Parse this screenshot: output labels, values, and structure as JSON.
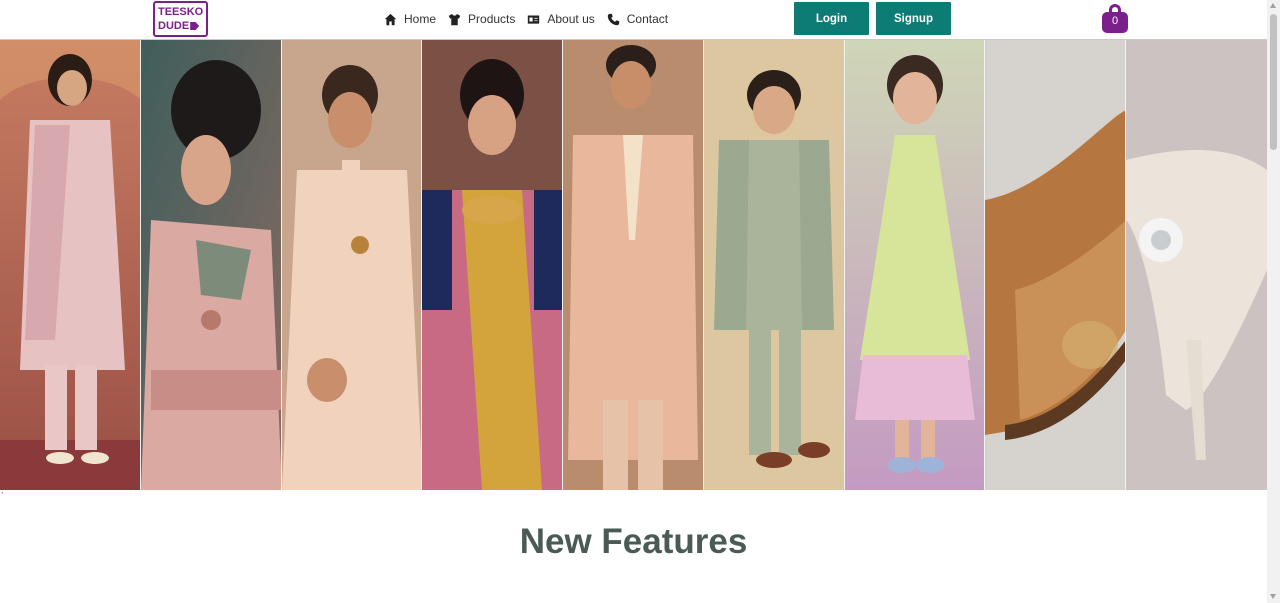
{
  "brand": {
    "line1": "TEESKO",
    "line2": "DUDE",
    "color": "#7b1f8a"
  },
  "nav": {
    "items": [
      {
        "label": "Home",
        "icon": "home-icon"
      },
      {
        "label": "Products",
        "icon": "shirt-icon"
      },
      {
        "label": "About us",
        "icon": "id-card-icon"
      },
      {
        "label": "Contact",
        "icon": "phone-icon"
      }
    ]
  },
  "auth": {
    "login_label": "Login",
    "signup_label": "Signup",
    "button_color": "#0d7c74"
  },
  "cart": {
    "count": "0",
    "icon": "shopping-bag-icon"
  },
  "banner": {
    "panels": [
      {
        "subject": "man in pink sherwani",
        "bg": "#b76c5c"
      },
      {
        "subject": "woman in lehenga with choker",
        "bg": "#3d5a58"
      },
      {
        "subject": "man in peach sherwani",
        "bg": "#c9a48a"
      },
      {
        "subject": "woman in silk saree",
        "bg": "#6e4a3f"
      },
      {
        "subject": "man in peach sherwani with pearls",
        "bg": "#b68b6c"
      },
      {
        "subject": "boy in sage kurta jacket",
        "bg": "#d8c49a"
      },
      {
        "subject": "girl in lime dress",
        "bg": "#c9a2c4"
      },
      {
        "subject": "tan embroidered loafer",
        "bg": "#d4d0cb"
      },
      {
        "subject": "white embellished heel",
        "bg": "#cdc6c3"
      }
    ]
  },
  "tick_mark": "`",
  "section": {
    "title": "New Features"
  }
}
